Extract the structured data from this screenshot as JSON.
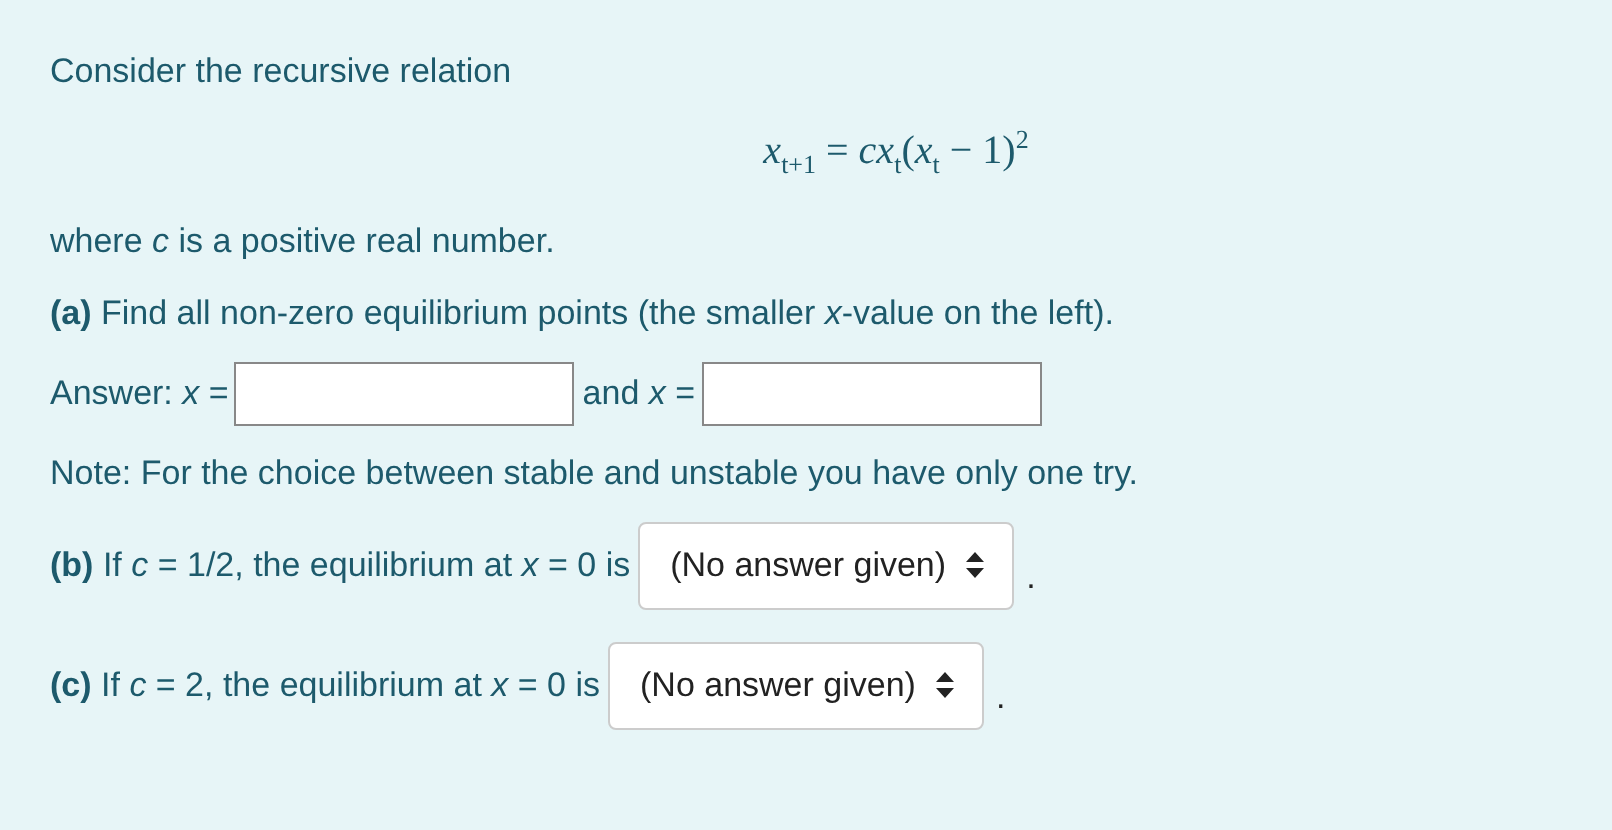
{
  "intro": "Consider the recursive relation",
  "formula": "*x*$_{t+1}$ = *cx*$_{t}$(*x*$_{t}$ − 1)$^{2}$",
  "where": "where *c* is a positive real number.",
  "part_a": {
    "prompt": "**(a)** Find all non-zero equilibrium points (the smaller *x*-value on the left).",
    "answers": [
      {
        "label": "Answer: *x* ="
      },
      {
        "label": "and *x* ="
      }
    ]
  },
  "note": "Note: For the choice between stable and unstable you have only one try.",
  "questions": [
    {
      "text": "**(b)**  If *c* = 1/2, the equilibrium at *x* = 0 is",
      "select": "(No answer given)",
      "after": "."
    },
    {
      "text": "**(c)** If *c* = 2, the equilibrium at *x* = 0 is",
      "select": "(No answer given)",
      "after": "."
    }
  ]
}
